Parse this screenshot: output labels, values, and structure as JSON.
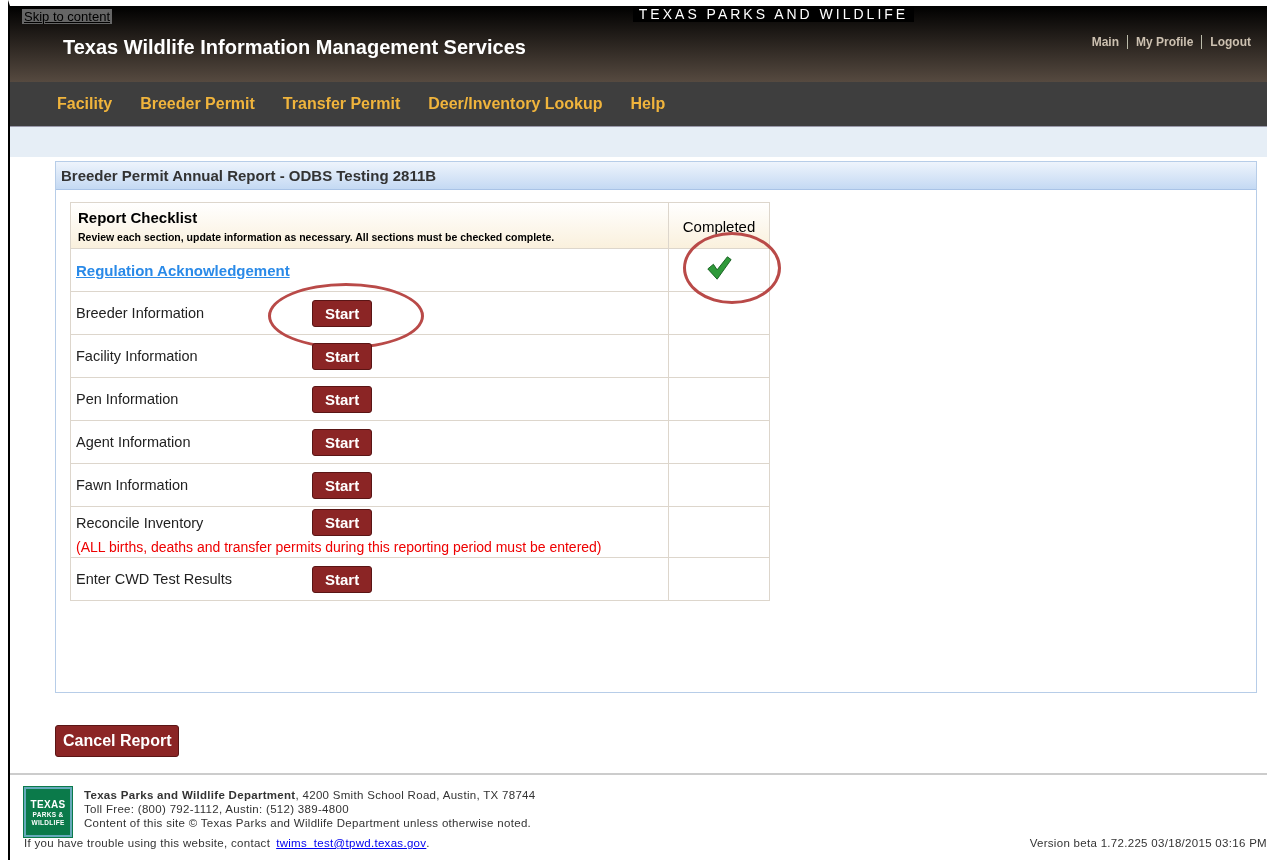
{
  "skip_link": "Skip to content",
  "brand_banner": "TEXAS PARKS AND WILDLIFE",
  "site_title": "Texas Wildlife Information Management Services",
  "user_links": [
    "Main",
    "My Profile",
    "Logout"
  ],
  "nav": [
    "Facility",
    "Breeder Permit",
    "Transfer Permit",
    "Deer/Inventory Lookup",
    "Help"
  ],
  "panel_title": "Breeder Permit Annual Report - ODBS Testing 2811B",
  "checklist": {
    "title": "Report Checklist",
    "subtitle": "Review each section, update information as necessary. All sections must be checked complete.",
    "completed_header": "Completed",
    "rows": [
      {
        "kind": "link",
        "label": "Regulation Acknowledgement",
        "completed": true,
        "circled": true
      },
      {
        "kind": "start",
        "label": "Breeder Information",
        "button": "Start",
        "completed": false,
        "circled": true
      },
      {
        "kind": "start",
        "label": "Facility Information",
        "button": "Start",
        "completed": false
      },
      {
        "kind": "start",
        "label": "Pen Information",
        "button": "Start",
        "completed": false
      },
      {
        "kind": "start",
        "label": "Agent Information",
        "button": "Start",
        "completed": false
      },
      {
        "kind": "start",
        "label": "Fawn Information",
        "button": "Start",
        "completed": false
      },
      {
        "kind": "start",
        "label": "Reconcile Inventory",
        "button": "Start",
        "completed": false,
        "note": "(ALL births, deaths and transfer permits during this reporting period must be entered)"
      },
      {
        "kind": "start",
        "label": "Enter CWD Test Results",
        "button": "Start",
        "completed": false
      }
    ]
  },
  "cancel_button": "Cancel Report",
  "footer": {
    "logo": [
      "TEXAS",
      "PARKS &",
      "WILDLIFE"
    ],
    "address": "**Texas Parks and Wildlife Department**, 4200 Smith School Road, Austin, TX 78744",
    "phone": "Toll Free: (800) 792-1112, Austin: (512) 389-4800",
    "copyright": "Content of this site © Texas Parks and Wildlife Department unless otherwise noted.",
    "trouble": "If you have trouble using this website, contact",
    "email": "twims_test@tpwd.texas.gov",
    "trouble_end": ".",
    "version": "Version beta 1.72.225 03/18/2015 03:16 PM"
  }
}
